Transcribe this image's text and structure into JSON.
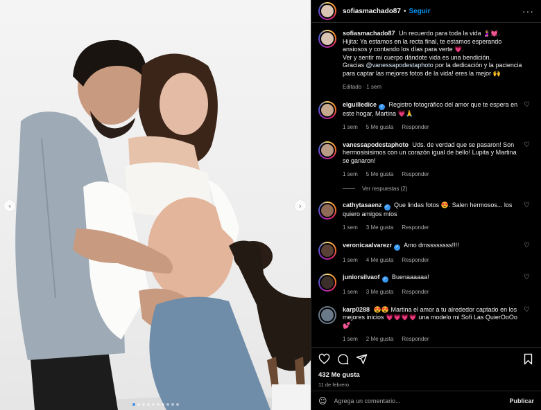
{
  "header": {
    "username": "sofiasmachado87",
    "separator": "•",
    "follow_label": "Seguir",
    "more_label": "···"
  },
  "caption": {
    "username": "sofiasmachado87",
    "text_1": "Un recuerdo para toda la vida 🤰💓.",
    "text_2": "Hijita: Ya estamos en la recta final, te estamos esperando ansiosos y contando los días para verte 💗.",
    "text_3": "Ver y sentir mi cuerpo dándote vida es una bendición.",
    "text_4a": "Gracias",
    "mention": "@vanessapodestaphoto",
    "text_4b": "por la dedicación y la paciencia para captar las mejores fotos de la vida! eres la mejor 🙌",
    "meta": "Editado · 1 sem"
  },
  "comments": [
    {
      "username": "elguilledice",
      "verified": true,
      "text": "Registro fotográfico del amor que te espera en este hogar, Martina 💗🙏",
      "time": "1 sem",
      "likes": "5 Me gusta",
      "reply": "Responder"
    },
    {
      "username": "vanessapodestaphoto",
      "verified": false,
      "text": "Uds. de verdad que se pasaron! Son hermosisisimos con un corazón igual de bello! Lupita y Martina se ganaron!",
      "time": "1 sem",
      "likes": "5 Me gusta",
      "reply": "Responder",
      "replies_label": "Ver respuestas (2)"
    },
    {
      "username": "cathytasaenz",
      "verified": true,
      "text": "Que lindas fotos 😍. Salen hermosos... los quiero amigos míos",
      "time": "1 sem",
      "likes": "3 Me gusta",
      "reply": "Responder"
    },
    {
      "username": "veronicaalvarezr",
      "verified": true,
      "text": "Amo dmssssssss!!!!",
      "time": "1 sem",
      "likes": "4 Me gusta",
      "reply": "Responder"
    },
    {
      "username": "juniorsilvaof",
      "verified": true,
      "text": "Buenaaaaaa!",
      "time": "1 sem",
      "likes": "3 Me gusta",
      "reply": "Responder"
    },
    {
      "username": "karp0288",
      "verified": false,
      "text": "😍😍 Martina el amor a tu alrededor captado en los mejores inicios 💗💗💗💗 una modelo mi Sofi Las QuierOoOo 💕",
      "time": "1 sem",
      "likes": "2 Me gusta",
      "reply": "Responder"
    }
  ],
  "footer": {
    "likes": "432 Me gusta",
    "date": "11 de febrero",
    "comment_placeholder": "Agrega un comentario...",
    "publish_label": "Publicar"
  },
  "carousel": {
    "total": 10,
    "active_index": 0
  },
  "colors": {
    "accent": "#0095f6",
    "verified": "#3897f0",
    "background": "#000000",
    "muted_text": "#a8a8a8"
  },
  "icons": [
    "heart-icon",
    "comment-icon",
    "share-icon",
    "save-icon",
    "emoji-icon",
    "chevron-left-icon",
    "chevron-right-icon"
  ]
}
